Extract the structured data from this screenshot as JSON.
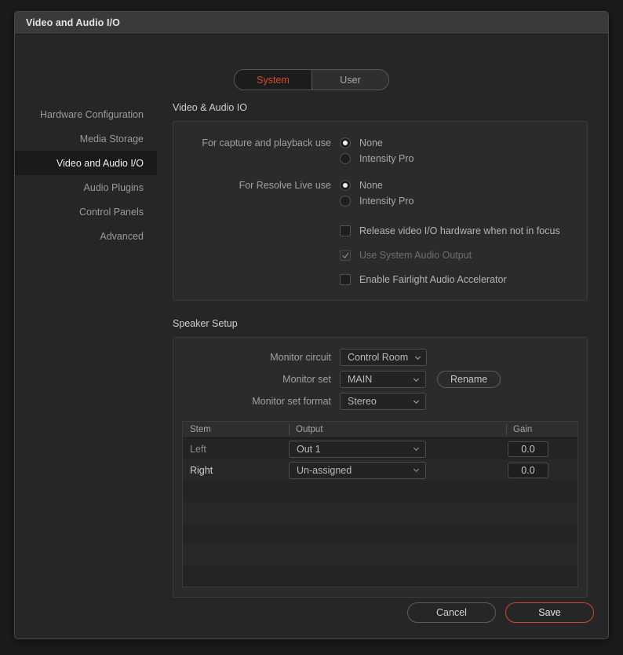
{
  "window": {
    "title": "Video and Audio I/O"
  },
  "tabs": [
    {
      "label": "System",
      "active": true
    },
    {
      "label": "User",
      "active": false
    }
  ],
  "sidebar": {
    "items": [
      {
        "label": "Hardware Configuration",
        "active": false
      },
      {
        "label": "Media Storage",
        "active": false
      },
      {
        "label": "Video and Audio I/O",
        "active": true
      },
      {
        "label": "Audio Plugins",
        "active": false
      },
      {
        "label": "Control Panels",
        "active": false
      },
      {
        "label": "Advanced",
        "active": false
      }
    ]
  },
  "video_audio_io": {
    "section_title": "Video & Audio IO",
    "capture_label": "For capture and playback use",
    "capture_options": [
      {
        "label": "None",
        "selected": true
      },
      {
        "label": "Intensity Pro",
        "selected": false
      }
    ],
    "live_label": "For Resolve Live use",
    "live_options": [
      {
        "label": "None",
        "selected": true
      },
      {
        "label": "Intensity Pro",
        "selected": false
      }
    ],
    "checkboxes": [
      {
        "label": "Release video I/O hardware when not in focus",
        "checked": false,
        "disabled": false
      },
      {
        "label": "Use System Audio Output",
        "checked": true,
        "disabled": true
      },
      {
        "label": "Enable Fairlight Audio Accelerator",
        "checked": false,
        "disabled": false
      }
    ]
  },
  "speaker_setup": {
    "section_title": "Speaker Setup",
    "monitor_circuit_label": "Monitor circuit",
    "monitor_circuit_value": "Control Room",
    "monitor_set_label": "Monitor set",
    "monitor_set_value": "MAIN",
    "rename_label": "Rename",
    "monitor_set_format_label": "Monitor set format",
    "monitor_set_format_value": "Stereo",
    "table": {
      "headers": [
        "Stem",
        "Output",
        "Gain"
      ],
      "rows": [
        {
          "stem": "Left",
          "output": "Out 1",
          "gain": "0.0",
          "dim": true
        },
        {
          "stem": "Right",
          "output": "Un-assigned",
          "gain": "0.0",
          "dim": false
        }
      ],
      "empty_row_count": 5
    }
  },
  "footer": {
    "cancel_label": "Cancel",
    "save_label": "Save"
  },
  "colors": {
    "accent": "#d1452a",
    "tab_active_text": "#d14d2c",
    "window_bg": "#262626",
    "titlebar_bg": "#3a3a3a",
    "panel_bg": "#2b2b2b"
  },
  "icons": {
    "chevron_down": "chevron-down-icon",
    "check": "check-icon"
  }
}
